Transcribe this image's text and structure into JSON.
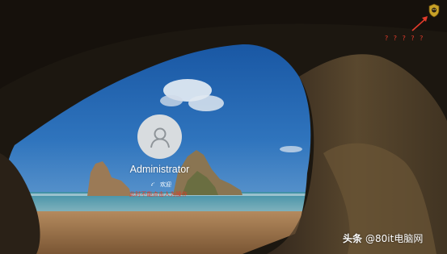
{
  "login": {
    "username": "Administrator",
    "status_text": "欢迎",
    "annotation": "此时不能点击人为操作"
  },
  "annotations": {
    "marker_text": "? ? ? ? ?"
  },
  "watermark": {
    "brand": "头条",
    "handle": "@80it电脑网"
  },
  "colors": {
    "annotation": "#e13a2b",
    "avatar_bg": "#d8dcdf",
    "avatar_fg": "#8e9499"
  },
  "icons": {
    "avatar": "user-silhouette-icon",
    "status": "spinner-icon",
    "tray": "shield-icon"
  }
}
